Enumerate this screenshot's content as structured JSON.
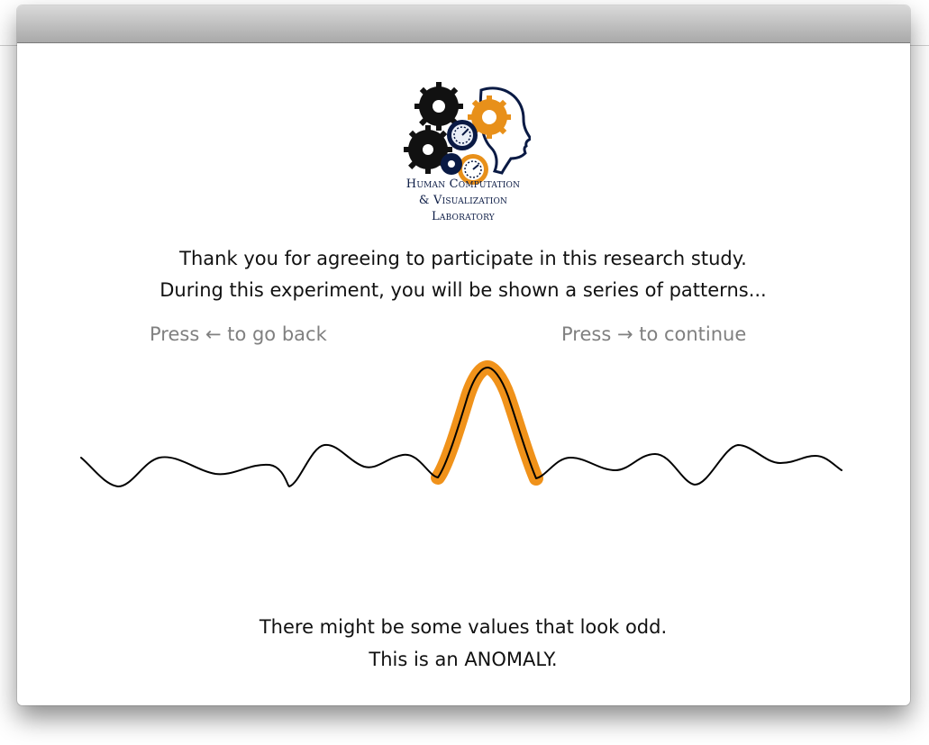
{
  "logo": {
    "line1": "Human Computation",
    "line2": "& Visualization",
    "line3": "Laboratory",
    "colors": {
      "orange": "#e8901a",
      "navy": "#0a1a44",
      "black": "#111111"
    }
  },
  "intro": {
    "line1": "Thank you for agreeing to participate in this research study.",
    "line2": "During this experiment, you will be shown a series of patterns..."
  },
  "nav": {
    "back_label": "Press ← to go back",
    "next_label": "Press → to continue"
  },
  "pattern": {
    "line_color": "#000000",
    "highlight_color": "#f0921a"
  },
  "outro": {
    "line1": "There might be some values that look odd.",
    "line2": "This is an ANOMALY."
  }
}
